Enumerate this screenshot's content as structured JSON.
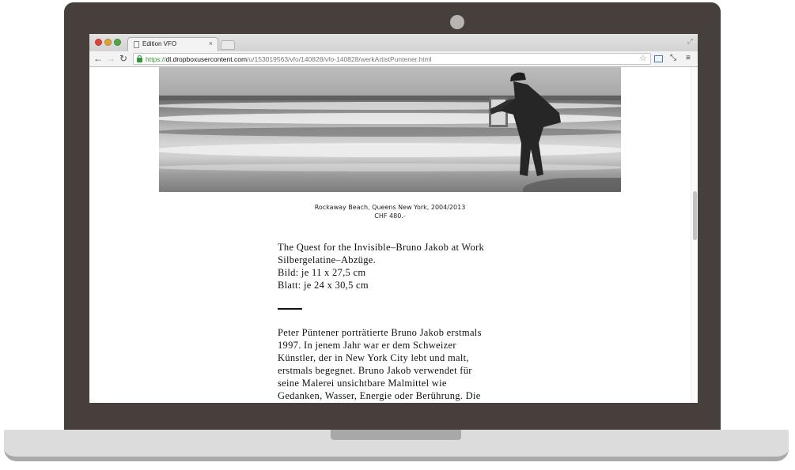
{
  "browser": {
    "tab_title": "Edition VFO",
    "tab_close": "×",
    "url_scheme": "https://",
    "url_host": "dl.dropboxusercontent.com",
    "url_path": "/u/153019563/vfo/140828/vfo-140828/werkArtistPuntener.html",
    "icons": {
      "back": "back-arrow-icon",
      "forward": "forward-arrow-icon",
      "reload": "reload-icon",
      "lock": "lock-icon",
      "bookmark": "star-icon",
      "menu": "hamburger-icon"
    }
  },
  "artwork": {
    "caption_title": "Rockaway Beach, Queens New York, 2004/2013",
    "caption_price": "CHF 480.-"
  },
  "details": {
    "lines": [
      "The Quest for the Invisible–Bruno Jakob at Work",
      "Silbergelatine–Abzüge.",
      "Bild: je 11 x 27,5 cm",
      "Blatt: je 24 x 30,5 cm"
    ]
  },
  "description": {
    "lines": [
      "Peter Püntener porträtierte Bruno Jakob erstmals",
      "1997. In jenem Jahr war er dem Schweizer",
      "Künstler, der in New York City lebt und malt,",
      "erstmals begegnet. Bruno Jakob verwendet für",
      "seine Malerei unsichtbare Malmittel wie",
      "Gedanken, Wasser, Energie oder Berührung. Die"
    ]
  },
  "colors": {
    "laptop_frame": "#473f3b",
    "url_secure": "#2e9a35"
  }
}
